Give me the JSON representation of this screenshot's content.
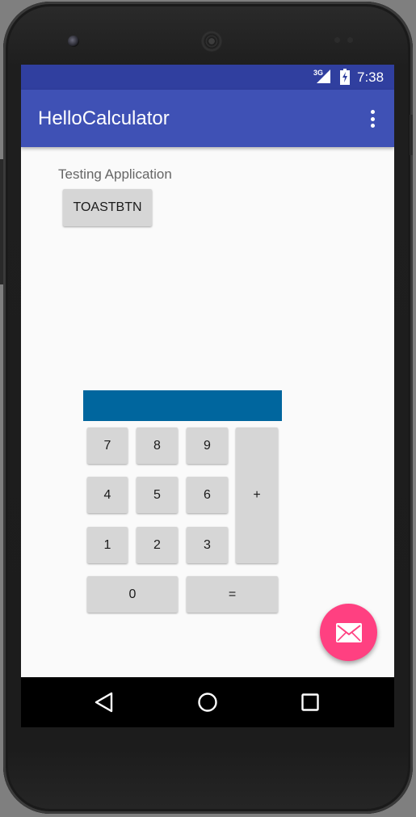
{
  "status_bar": {
    "network": "3G",
    "time": "7:38"
  },
  "app_bar": {
    "title": "HelloCalculator",
    "menu_icon": "overflow-menu-icon"
  },
  "content": {
    "label": "Testing Application",
    "toast_button": "TOASTBTN"
  },
  "calculator": {
    "display_value": "",
    "keys": {
      "seven": "7",
      "eight": "8",
      "nine": "9",
      "four": "4",
      "five": "5",
      "six": "6",
      "one": "1",
      "two": "2",
      "three": "3",
      "zero": "0",
      "plus": "+",
      "equals": "="
    }
  },
  "fab": {
    "icon": "mail-icon"
  },
  "nav_bar": {
    "back_icon": "back-triangle-icon",
    "home_icon": "home-circle-icon",
    "recents_icon": "recents-square-icon"
  },
  "colors": {
    "status_bar": "#303f9f",
    "app_bar": "#3f51b5",
    "display": "#00669e",
    "fab": "#ff4081",
    "button": "#d6d6d6"
  }
}
